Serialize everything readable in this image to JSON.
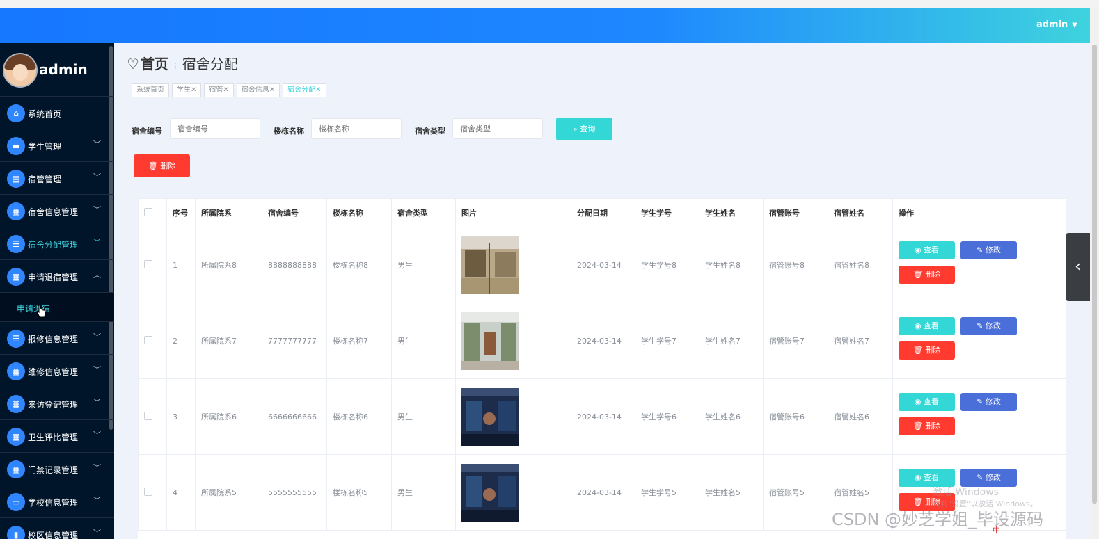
{
  "header": {
    "user": "admin"
  },
  "sidebar": {
    "profile_name": "admin",
    "items": [
      {
        "label": "系统首页",
        "icon": "home-icon"
      },
      {
        "label": "学生管理",
        "icon": "person-icon"
      },
      {
        "label": "宿管管理",
        "icon": "clipboard-icon"
      },
      {
        "label": "宿舍信息管理",
        "icon": "grid-icon"
      },
      {
        "label": "宿舍分配管理",
        "icon": "list-icon"
      },
      {
        "label": "申请退宿管理",
        "icon": "apps-icon"
      },
      {
        "label": "申请退宿",
        "icon": ""
      },
      {
        "label": "报修信息管理",
        "icon": "list-icon"
      },
      {
        "label": "维修信息管理",
        "icon": "apps-icon"
      },
      {
        "label": "来访登记管理",
        "icon": "apps-icon"
      },
      {
        "label": "卫生评比管理",
        "icon": "apps-icon"
      },
      {
        "label": "门禁记录管理",
        "icon": "apps-icon"
      },
      {
        "label": "学校信息管理",
        "icon": "chat-icon"
      },
      {
        "label": "校区信息管理",
        "icon": "bar-chart-icon"
      }
    ]
  },
  "breadcrumb": {
    "home": "首页",
    "current": "宿舍分配"
  },
  "tags": [
    "系统首页",
    "学生✕",
    "宿管✕",
    "宿舍信息✕",
    "宿舍分配✕"
  ],
  "search": {
    "dorm_no_label": "宿舍编号",
    "dorm_no_placeholder": "宿舍编号",
    "building_label": "楼栋名称",
    "building_placeholder": "楼栋名称",
    "type_label": "宿舍类型",
    "type_placeholder": "宿舍类型",
    "query_label": "查询"
  },
  "toolbar": {
    "delete_label": "删除"
  },
  "table": {
    "headers": [
      "序号",
      "所属院系",
      "宿舍编号",
      "楼栋名称",
      "宿舍类型",
      "图片",
      "分配日期",
      "学生学号",
      "学生姓名",
      "宿管账号",
      "宿管姓名",
      "操作"
    ],
    "rows": [
      [
        "1",
        "所属院系8",
        "8888888888",
        "楼栋名称8",
        "男生",
        "2024-03-14",
        "学生学号8",
        "学生姓名8",
        "宿管账号8",
        "宿管姓名8"
      ],
      [
        "2",
        "所属院系7",
        "7777777777",
        "楼栋名称7",
        "男生",
        "2024-03-14",
        "学生学号7",
        "学生姓名7",
        "宿管账号7",
        "宿管姓名7"
      ],
      [
        "3",
        "所属院系6",
        "6666666666",
        "楼栋名称6",
        "男生",
        "2024-03-14",
        "学生学号6",
        "学生姓名6",
        "宿管账号6",
        "宿管姓名6"
      ],
      [
        "4",
        "所属院系5",
        "5555555555",
        "楼栋名称5",
        "男生",
        "2024-03-14",
        "学生学号5",
        "学生姓名5",
        "宿管账号5",
        "宿管姓名5"
      ]
    ],
    "actions": {
      "view": "查看",
      "edit": "修改",
      "delete": "删除"
    }
  },
  "overlay": {
    "watermark": "CSDN @妙芝学姐_毕设源码",
    "windows_line1": "激活 Windows",
    "windows_line2": "转到\"设置\"以激活 Windows。",
    "tray": "中"
  },
  "colors": {
    "accent": "#3ed3de",
    "primary": "#1677ff",
    "danger": "#ff3b30",
    "edit": "#4b6fd8",
    "sidebar": "#001529"
  }
}
